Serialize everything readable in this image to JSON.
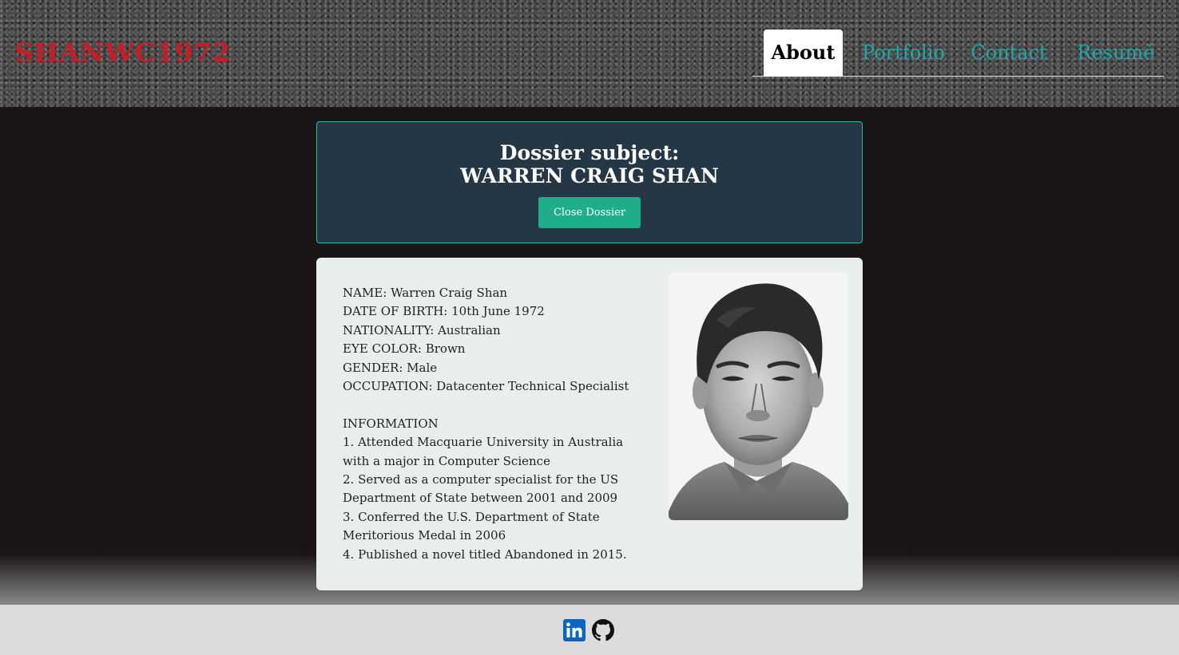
{
  "header": {
    "logo": "SHANWC1972",
    "nav": [
      {
        "label": "About",
        "active": true
      },
      {
        "label": "Portfolio",
        "active": false
      },
      {
        "label": "Contact",
        "active": false
      },
      {
        "label": "Resumé",
        "active": false
      }
    ]
  },
  "dossier": {
    "title_line1": "Dossier subject:",
    "title_line2": "WARREN CRAIG SHAN",
    "close_button": "Close Dossier"
  },
  "profile": {
    "fields": [
      "NAME: Warren Craig Shan",
      "DATE OF BIRTH: 10th June 1972",
      "NATIONALITY: Australian",
      "EYE COLOR: Brown",
      "GENDER: Male",
      "OCCUPATION: Datacenter Technical Specialist"
    ],
    "info_heading": "INFORMATION",
    "info_lines": [
      "1. Attended Macquarie University in Australia",
      "with a major in Computer Science",
      "2. Served as a computer specialist for the US",
      "Department of State between 2001 and 2009",
      "3. Conferred the U.S. Department of State",
      "Meritorious Medal in 2006",
      "4. Published a novel titled Abandoned in 2015."
    ]
  },
  "footer": {
    "icons": [
      "linkedin-icon",
      "github-icon"
    ]
  },
  "colors": {
    "logo": "#c0202a",
    "nav_link": "#1fa7a7",
    "dossier_bg": "#253645",
    "dossier_border": "#2fb8a4",
    "button": "#1fae8c",
    "linkedin": "#0a66c2"
  }
}
